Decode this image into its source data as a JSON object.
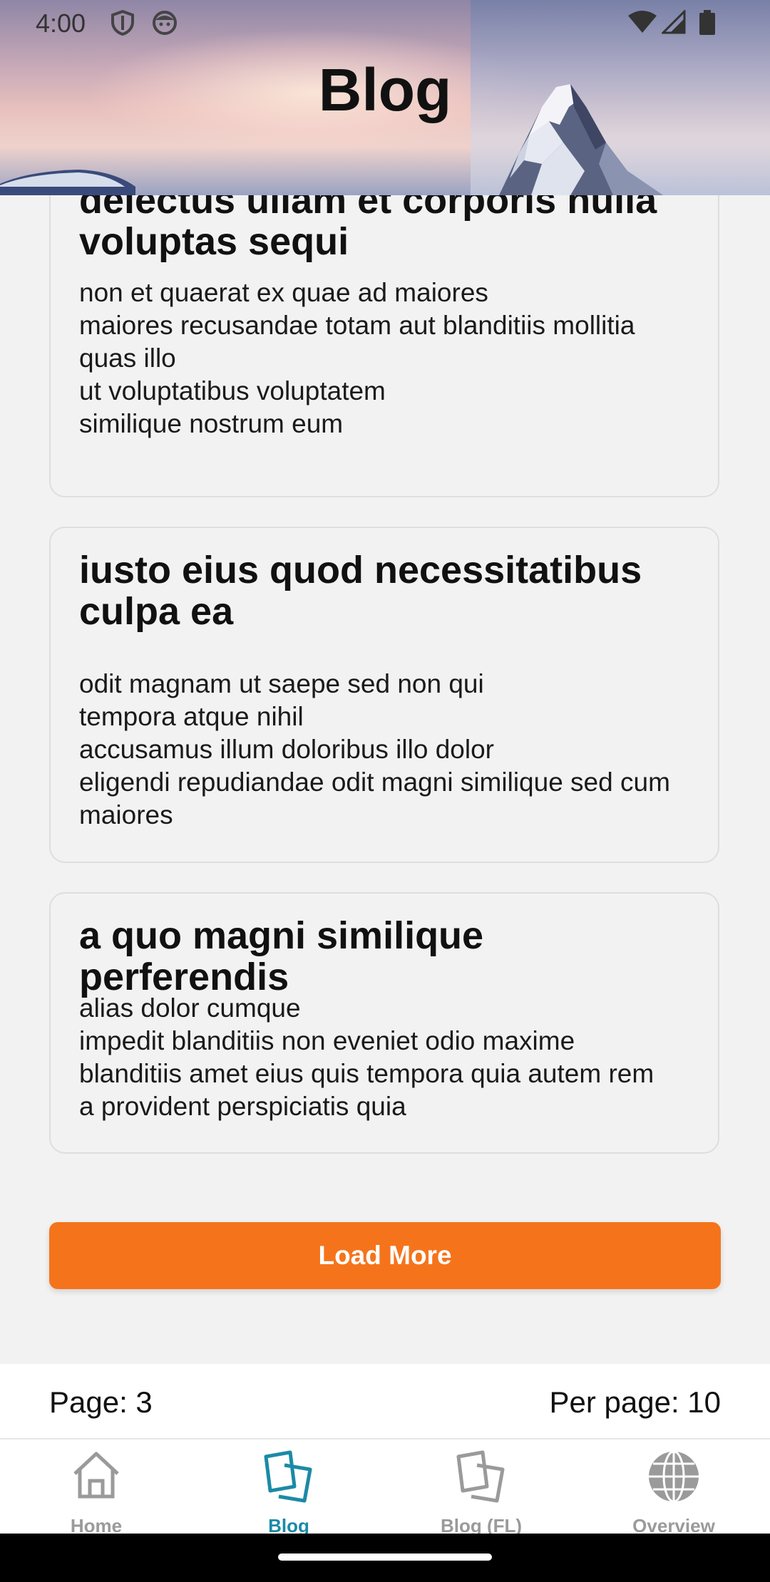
{
  "status_bar": {
    "time": "4:00"
  },
  "header": {
    "title": "Blog"
  },
  "posts": [
    {
      "title": "delectus ullam et corporis nulla voluptas sequi",
      "body": "non et quaerat ex quae ad maiores\nmaiores recusandae totam aut blanditiis mollitia quas illo\nut voluptatibus voluptatem\nsimilique nostrum eum"
    },
    {
      "title": "iusto eius quod necessitatibus culpa ea",
      "body": "odit magnam ut saepe sed non qui\ntempora atque nihil\naccusamus illum doloribus illo dolor\neligendi repudiandae odit magni similique sed cum maiores"
    },
    {
      "title": "a quo magni similique perferendis",
      "body": "alias dolor cumque\nimpedit blanditiis non eveniet odio maxime\nblanditiis amet eius quis tempora quia autem rem\na provident perspiciatis quia"
    }
  ],
  "load_more_label": "Load More",
  "page_info": {
    "page": "Page: 3",
    "per_page": "Per page: 10"
  },
  "nav": {
    "items": [
      {
        "label": "Home",
        "icon": "home-icon"
      },
      {
        "label": "Blog",
        "icon": "blog-icon"
      },
      {
        "label": "Blog (FL)",
        "icon": "blog-fl-icon"
      },
      {
        "label": "Overview",
        "icon": "globe-icon"
      }
    ],
    "active": "Blog"
  },
  "colors": {
    "accent": "#f5741b",
    "active_nav": "#1b8aa6",
    "inactive_nav": "#9a9a9a"
  }
}
